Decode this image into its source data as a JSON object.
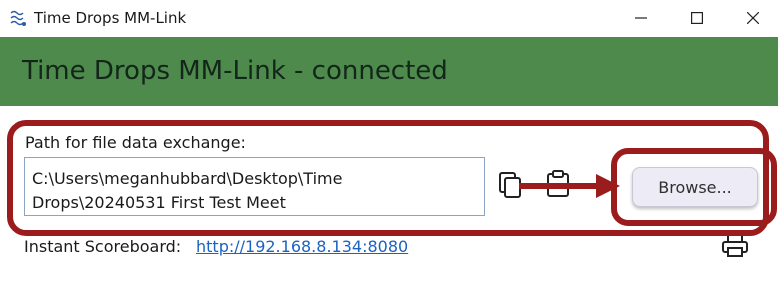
{
  "window": {
    "title": "Time Drops MM-Link",
    "icon": "app-logo-icon",
    "controls": [
      "minimize-icon",
      "maximize-icon",
      "close-icon"
    ]
  },
  "header": {
    "text": "Time Drops MM-Link - connected",
    "background": "#4d8a4c"
  },
  "exchange": {
    "label": "Path for file data exchange:",
    "path": "C:\\Users\\meganhubbard\\Desktop\\Time\nDrops\\20240531 First Test Meet",
    "copy_icon": "copy-icon",
    "paste_icon": "clipboard-icon",
    "browse_label": "Browse..."
  },
  "scoreboard": {
    "label": "Instant Scoreboard:",
    "url": "http://192.168.8.134:8080",
    "print_icon": "printer-icon"
  },
  "annotation": {
    "color": "#9b1c1c",
    "shapes": [
      "rounded-box-path-area",
      "arrow",
      "rounded-box-browse"
    ]
  }
}
